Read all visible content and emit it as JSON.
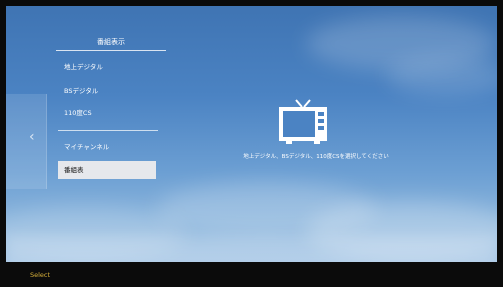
{
  "menu": {
    "header": "番組表示",
    "items": [
      {
        "label": "地上デジタル",
        "selected": false
      },
      {
        "label": "BSデジタル",
        "selected": false
      },
      {
        "label": "110度CS",
        "selected": false
      },
      {
        "label": "マイチャンネル",
        "selected": false
      },
      {
        "label": "番組表",
        "selected": true
      }
    ]
  },
  "message": "地上デジタル、BSデジタル、110度CSを選択してください",
  "footer": {
    "label": "Select"
  },
  "icons": {
    "tv": "tv-icon",
    "back": "chevron-left-icon"
  },
  "colors": {
    "selected_bg": "#e6e8ec",
    "footer_text": "#d8b13a",
    "sky": "#4b83c3"
  }
}
